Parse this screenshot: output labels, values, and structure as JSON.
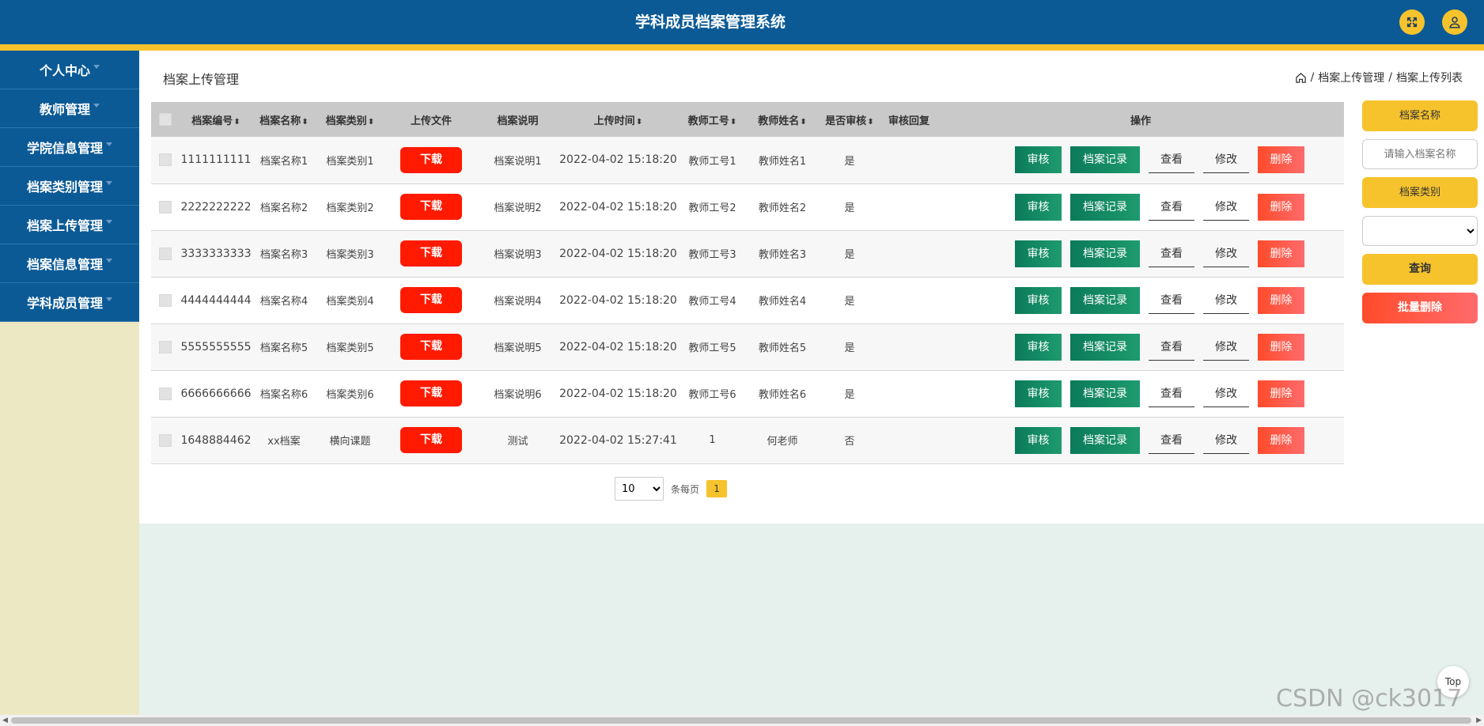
{
  "header": {
    "title": "学科成员档案管理系统",
    "buttons": [
      "fullscreen-icon",
      "user-icon"
    ]
  },
  "sidebar": {
    "items": [
      {
        "label": "个人中心"
      },
      {
        "label": "教师管理"
      },
      {
        "label": "学院信息管理"
      },
      {
        "label": "档案类别管理"
      },
      {
        "label": "档案上传管理"
      },
      {
        "label": "档案信息管理"
      },
      {
        "label": "学科成员管理"
      }
    ]
  },
  "main": {
    "page_title": "档案上传管理",
    "breadcrumb": [
      "档案上传管理",
      "档案上传列表"
    ],
    "columns": [
      "档案编号",
      "档案名称",
      "档案类别",
      "上传文件",
      "档案说明",
      "上传时间",
      "教师工号",
      "教师姓名",
      "是否审核",
      "审核回复",
      "操作"
    ],
    "rows": [
      {
        "id": "1111111111",
        "name": "档案名称1",
        "category": "档案类别1",
        "file": "下载",
        "desc": "档案说明1",
        "time": "2022-04-02 15:18:20",
        "tno": "教师工号1",
        "tname": "教师姓名1",
        "audited": "是",
        "reply": ""
      },
      {
        "id": "2222222222",
        "name": "档案名称2",
        "category": "档案类别2",
        "file": "下载",
        "desc": "档案说明2",
        "time": "2022-04-02 15:18:20",
        "tno": "教师工号2",
        "tname": "教师姓名2",
        "audited": "是",
        "reply": ""
      },
      {
        "id": "3333333333",
        "name": "档案名称3",
        "category": "档案类别3",
        "file": "下载",
        "desc": "档案说明3",
        "time": "2022-04-02 15:18:20",
        "tno": "教师工号3",
        "tname": "教师姓名3",
        "audited": "是",
        "reply": ""
      },
      {
        "id": "4444444444",
        "name": "档案名称4",
        "category": "档案类别4",
        "file": "下载",
        "desc": "档案说明4",
        "time": "2022-04-02 15:18:20",
        "tno": "教师工号4",
        "tname": "教师姓名4",
        "audited": "是",
        "reply": ""
      },
      {
        "id": "5555555555",
        "name": "档案名称5",
        "category": "档案类别5",
        "file": "下载",
        "desc": "档案说明5",
        "time": "2022-04-02 15:18:20",
        "tno": "教师工号5",
        "tname": "教师姓名5",
        "audited": "是",
        "reply": ""
      },
      {
        "id": "6666666666",
        "name": "档案名称6",
        "category": "档案类别6",
        "file": "下载",
        "desc": "档案说明6",
        "time": "2022-04-02 15:18:20",
        "tno": "教师工号6",
        "tname": "教师姓名6",
        "audited": "是",
        "reply": ""
      },
      {
        "id": "1648884462",
        "name": "xx档案",
        "category": "横向课题",
        "file": "下载",
        "desc": "测试",
        "time": "2022-04-02 15:27:41",
        "tno": "1",
        "tname": "何老师",
        "audited": "否",
        "reply": ""
      }
    ],
    "actions": {
      "audit": "审核",
      "record": "档案记录",
      "view": "查看",
      "edit": "修改",
      "delete": "删除"
    }
  },
  "pagination": {
    "page_size": "10",
    "per_page_label": "条每页",
    "current_page": "1"
  },
  "filter": {
    "name_label": "档案名称",
    "name_placeholder": "请输入档案名称",
    "category_label": "档案类别",
    "category_value": "",
    "query_button": "查询",
    "batch_delete_button": "批量删除"
  },
  "misc": {
    "to_top": "Top",
    "watermark": "CSDN @ck3017"
  },
  "colors": {
    "header": "#0b5a96",
    "accent": "#f6c32d",
    "danger": "#ff1a00",
    "success": "#0b7a5a",
    "sidebar_bg": "#ebe8c3"
  }
}
